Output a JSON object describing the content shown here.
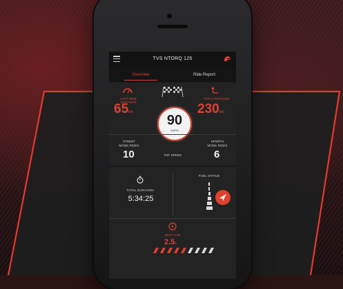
{
  "app": {
    "title": "TVS NTORQ 125",
    "menu_icon": "hamburger-menu-icon",
    "helmet_icon": "helmet-icon"
  },
  "tabs": [
    {
      "label": "Overview",
      "active": true
    },
    {
      "label": "Ride Report",
      "active": false
    }
  ],
  "stats": {
    "last_ride": {
      "label_line1": "LAST RIDE",
      "label_line2": "DISTANCE",
      "value": "65",
      "unit": "km",
      "icon": "speedometer-icon"
    },
    "total_distance": {
      "label_line1": "TOTAL",
      "label_line2": "DISTANCE",
      "value": "230",
      "unit": "km",
      "icon": "route-icon"
    },
    "top_speed": {
      "value": "90",
      "unit": "KMPH",
      "label": "TOP SPEED",
      "icon": "chequered-flags-icon"
    },
    "street_mode": {
      "label_line1": "STREET",
      "label_line2": "MODE RIDES",
      "value": "10"
    },
    "sports_mode": {
      "label_line1": "SPORTS",
      "label_line2": "MODE RIDES",
      "value": "6"
    },
    "ride_duration": {
      "label": "TOTAL DURATION",
      "value": "5:34:25",
      "icon": "stopwatch-icon"
    },
    "fuel_status": {
      "label": "FUEL STATUS",
      "icon": "fuel-gauge-icon"
    },
    "best_060": {
      "label": "BEST 0-60",
      "value": "2.5",
      "unit": "s",
      "icon": "bolt-icon"
    }
  },
  "colors": {
    "accent": "#e0412f",
    "panel": "#232324",
    "background": "#2a1414"
  }
}
